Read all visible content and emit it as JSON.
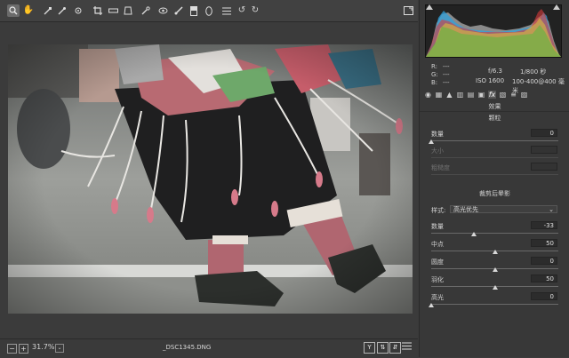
{
  "toolbar": {
    "tools": [
      "zoom-icon",
      "hand-icon",
      "white-balance-icon",
      "color-sampler-icon",
      "target-adjust-icon",
      "crop-icon",
      "straighten-icon",
      "transform-icon",
      "spot-removal-icon",
      "red-eye-icon",
      "adjustment-brush-icon",
      "graduated-filter-icon",
      "radial-filter-icon",
      "list-icon",
      "rotate-ccw-icon",
      "rotate-cw-icon"
    ],
    "selected_tool": "zoom-icon"
  },
  "info": {
    "r_label": "R:",
    "r_value": "---",
    "g_label": "G:",
    "g_value": "---",
    "b_label": "B:",
    "b_value": "---",
    "aperture": "f/6.3",
    "shutter": "1/800 秒",
    "iso": "ISO 1600",
    "lens": "100-400@400 毫米"
  },
  "panel": {
    "section_title": "效果",
    "grain": {
      "title": "颗粒",
      "amount_label": "数量",
      "amount_value": "0",
      "amount_level": 0,
      "size_label": "大小",
      "roughness_label": "粗糙度"
    },
    "vignette": {
      "title": "裁剪后晕影",
      "style_label": "样式:",
      "style_value": "高光优先",
      "amount_label": "数量",
      "amount_value": "-33",
      "amount_level": -33,
      "midpoint_label": "中点",
      "midpoint_value": "50",
      "midpoint_level": 50,
      "roundness_label": "圆度",
      "roundness_value": "0",
      "roundness_level": 0,
      "feather_label": "羽化",
      "feather_value": "50",
      "feather_level": 50,
      "highlights_label": "高光",
      "highlights_value": "0",
      "highlights_level": 0
    }
  },
  "status": {
    "zoom": "31.7%",
    "filename": "_DSC1345.DNG"
  }
}
